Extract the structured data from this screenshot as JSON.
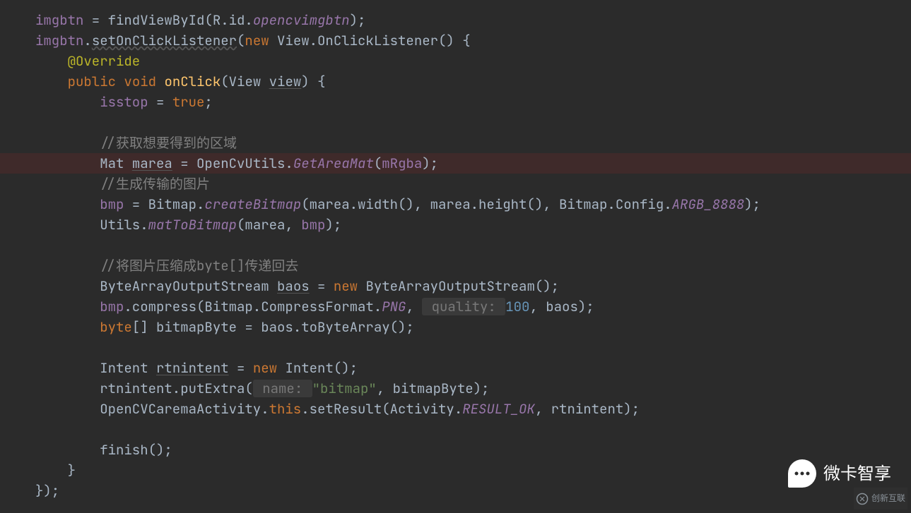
{
  "code": {
    "l01": {
      "a": "imgbtn",
      "b": " = ",
      "c": "findViewById",
      "d": "(R.id.",
      "e": "opencvimgbtn",
      "f": ");"
    },
    "l02": {
      "a": "imgbtn",
      "b": ".",
      "c": "setOnClickListener",
      "d": "(",
      "e": "new ",
      "f": "View.OnClickListener() {"
    },
    "l03": {
      "a": "@Override"
    },
    "l04": {
      "a": "public ",
      "b": "void ",
      "c": "onClick",
      "d": "(View ",
      "e": "view",
      "f": ") {"
    },
    "l05": {
      "a": "isstop",
      "b": " = ",
      "c": "true",
      "d": ";"
    },
    "l06": {
      "a": "//获取想要得到的区域"
    },
    "l07": {
      "a": "Mat ",
      "b": "marea",
      "c": " = OpenCvUtils.",
      "d": "GetAreaMat",
      "e": "(",
      "f": "mRgba",
      "g": ");"
    },
    "l08": {
      "a": "//生成传输的图片"
    },
    "l09": {
      "a": "bmp",
      "b": " = Bitmap.",
      "c": "createBitmap",
      "d": "(marea.width(), marea.height(), Bitmap.Config.",
      "e": "ARGB_8888",
      "f": ");"
    },
    "l10": {
      "a": "Utils.",
      "b": "matToBitmap",
      "c": "(marea, ",
      "d": "bmp",
      "e": ");"
    },
    "l11": {
      "a": "//将图片压缩成byte[]传递回去"
    },
    "l12": {
      "a": "ByteArrayOutputStream ",
      "b": "baos",
      "c": " = ",
      "d": "new ",
      "e": "ByteArrayOutputStream();"
    },
    "l13": {
      "a": "bmp",
      "b": ".compress(Bitmap.CompressFormat.",
      "c": "PNG",
      "d": ", ",
      "hint": " quality: ",
      "e": "100",
      "f": ", baos);"
    },
    "l14": {
      "a": "byte",
      "b": "[] bitmapByte = baos.toByteArray();"
    },
    "l15": {
      "a": "Intent ",
      "b": "rtnintent",
      "c": " = ",
      "d": "new ",
      "e": "Intent();"
    },
    "l16": {
      "a": "rtnintent.putExtra(",
      "hint": " name: ",
      "b": "\"bitmap\"",
      "c": ", bitmapByte);"
    },
    "l17": {
      "a": "OpenCVCaremaActivity.",
      "b": "this",
      "c": ".setResult(Activity.",
      "d": "RESULT_OK",
      "e": ", rtnintent);"
    },
    "l18": {
      "a": "finish();"
    },
    "l19": {
      "a": "}"
    },
    "l20": {
      "a": "});"
    }
  },
  "watermark1": "微卡智享",
  "watermark2": "创新互联"
}
